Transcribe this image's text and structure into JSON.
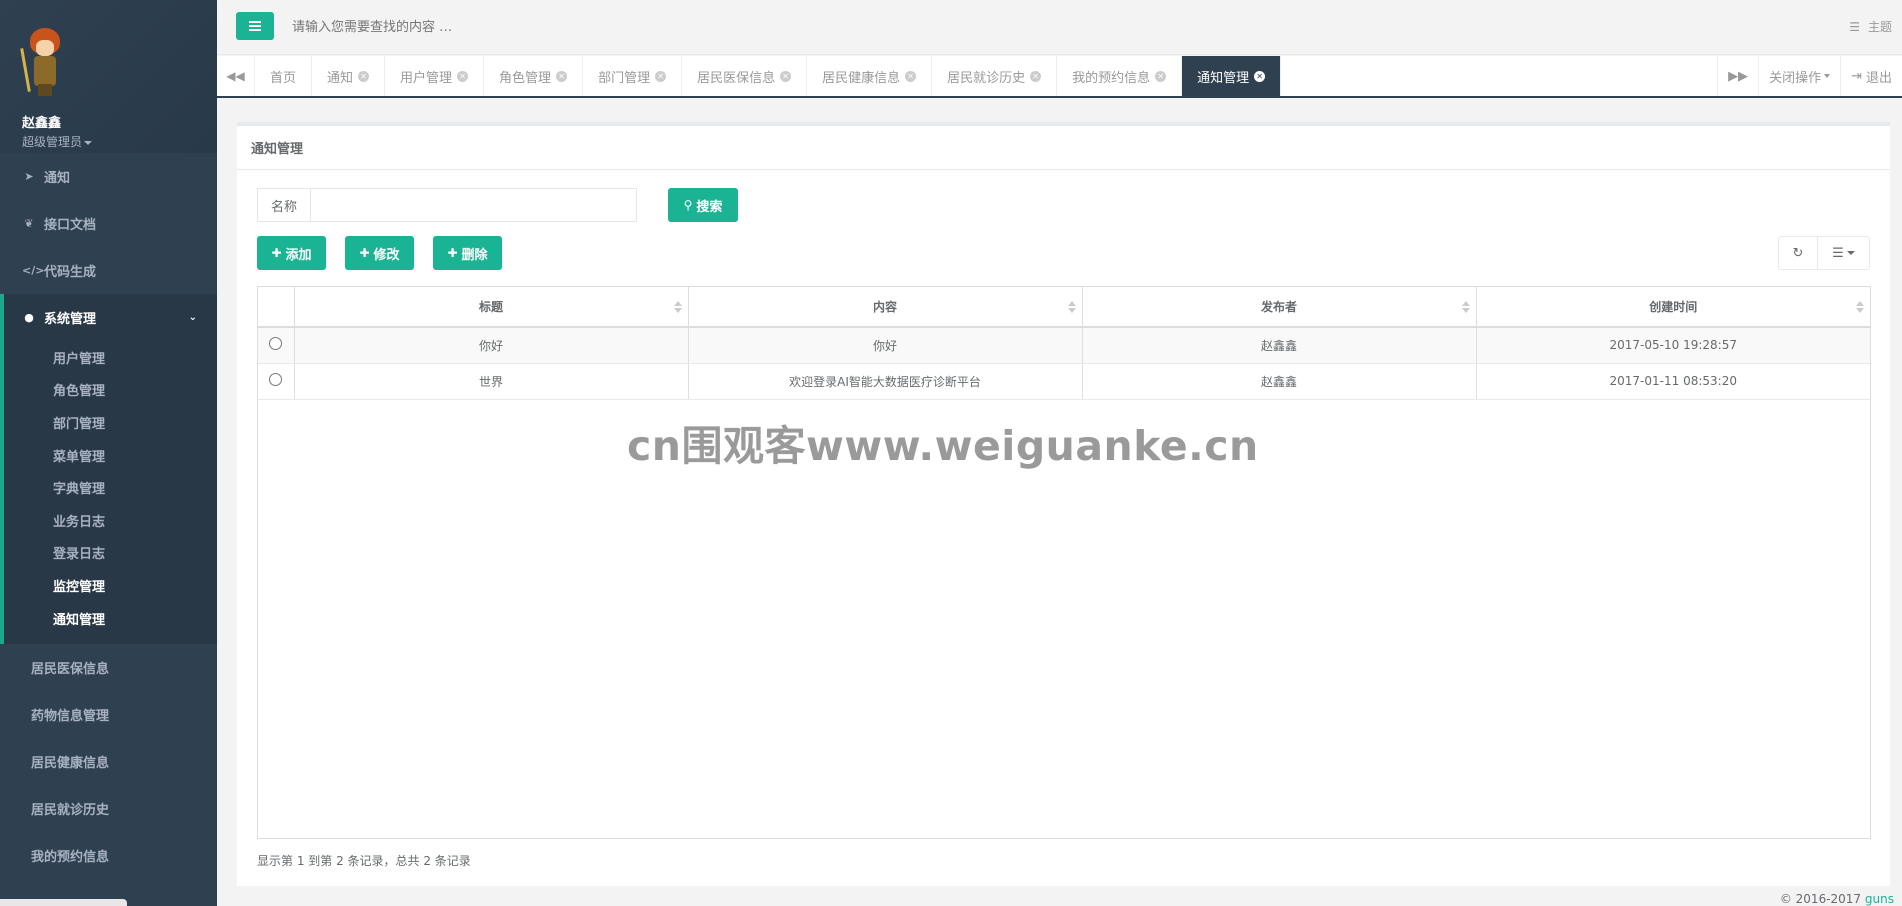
{
  "sidebar": {
    "profile": {
      "name": "赵鑫鑫",
      "role": "超级管理员"
    },
    "top_items": [
      {
        "label": "通知",
        "icon": "paper-plane-icon"
      },
      {
        "label": "接口文档",
        "icon": "leaf-icon"
      },
      {
        "label": "代码生成",
        "icon": "code-icon"
      }
    ],
    "group": {
      "label": "系统管理",
      "icon": "user-icon",
      "items": [
        "用户管理",
        "角色管理",
        "部门管理",
        "菜单管理",
        "字典管理",
        "业务日志",
        "登录日志",
        "监控管理",
        "通知管理"
      ]
    },
    "bottom_items": [
      "居民医保信息",
      "药物信息管理",
      "居民健康信息",
      "居民就诊历史",
      "我的预约信息"
    ]
  },
  "topbar": {
    "search_placeholder": "请输入您需要查找的内容 …",
    "theme_label": "主题"
  },
  "tabs": {
    "items": [
      "首页",
      "通知",
      "用户管理",
      "角色管理",
      "部门管理",
      "居民医保信息",
      "居民健康信息",
      "居民就诊历史",
      "我的预约信息",
      "通知管理"
    ],
    "active_index": 9,
    "close_ops_label": "关闭操作",
    "logout_label": "退出"
  },
  "panel": {
    "title": "通知管理",
    "search": {
      "label": "名称",
      "value": "",
      "button": "搜索"
    },
    "actions": {
      "add": "添加",
      "edit": "修改",
      "delete": "删除"
    }
  },
  "table": {
    "columns": [
      "标题",
      "内容",
      "发布者",
      "创建时间"
    ],
    "rows": [
      [
        "你好",
        "你好",
        "赵鑫鑫",
        "2017-05-10 19:28:57"
      ],
      [
        "世界",
        "欢迎登录AI智能大数据医疗诊断平台",
        "赵鑫鑫",
        "2017-01-11 08:53:20"
      ]
    ]
  },
  "pagination_info": "显示第 1 到第 2 条记录，总共 2 条记录",
  "watermark": "cn围观客www.weiguanke.cn",
  "copyright": {
    "text": "© 2016-2017",
    "brand": "guns"
  },
  "colors": {
    "sidebar": "#2f4050",
    "accent": "#1ab394",
    "active_tab": "#2f4050"
  }
}
